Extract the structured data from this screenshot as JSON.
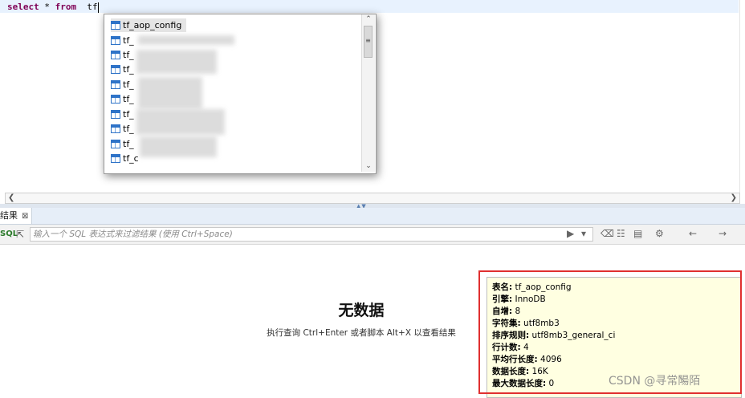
{
  "editor": {
    "sql_keyword1": "select",
    "sql_star": "*",
    "sql_keyword2": "from",
    "sql_typed": "tf"
  },
  "autocomplete": {
    "items": [
      {
        "label": "tf_aop_config",
        "selected": true
      },
      {
        "label": "tf_"
      },
      {
        "label": "tf_"
      },
      {
        "label": "tf_"
      },
      {
        "label": "tf_"
      },
      {
        "label": "tf_"
      },
      {
        "label": "tf_"
      },
      {
        "label": "tf_"
      },
      {
        "label": "tf_"
      },
      {
        "label": "tf_c"
      }
    ]
  },
  "results_tab": {
    "label": "结果",
    "close_icon": "close-icon"
  },
  "filter": {
    "badge": "SQL",
    "placeholder": "输入一个 SQL 表达式来过滤结果 (使用 Ctrl+Space)"
  },
  "results": {
    "empty_title": "无数据",
    "empty_hint": "执行查询 Ctrl+Enter 或者脚本 Alt+X 以查看结果"
  },
  "tooltip": {
    "rows": [
      {
        "key": "表名:",
        "value": "tf_aop_config"
      },
      {
        "key": "引擎:",
        "value": "InnoDB"
      },
      {
        "key": "自增:",
        "value": "8"
      },
      {
        "key": "字符集:",
        "value": "utf8mb3"
      },
      {
        "key": "排序规则:",
        "value": "utf8mb3_general_ci"
      },
      {
        "key": "行计数:",
        "value": "4"
      },
      {
        "key": "平均行长度:",
        "value": "4096"
      },
      {
        "key": "数据长度:",
        "value": "16K"
      },
      {
        "key": "最大数据长度:",
        "value": "0"
      }
    ]
  },
  "watermark": "CSDN @寻常̀陽陌",
  "colors": {
    "keyword": "#7f0055",
    "highlight_box": "#e03030",
    "tooltip_bg": "#ffffe1"
  }
}
